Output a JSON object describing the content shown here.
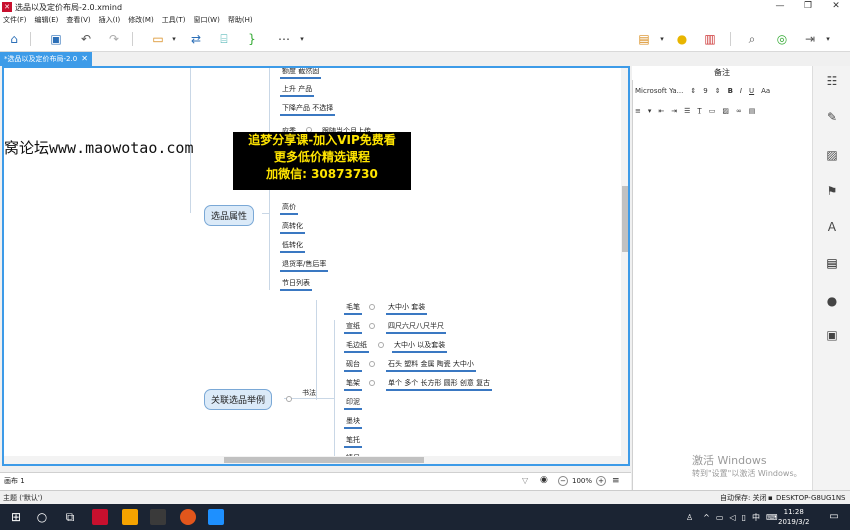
{
  "window": {
    "title": "选品以及定价布局-2.0.xmind",
    "min_icon": "—",
    "max_icon": "❐",
    "close_icon": "✕"
  },
  "menu": [
    "文件(F)",
    "编辑(E)",
    "查看(V)",
    "插入(I)",
    "修改(M)",
    "工具(T)",
    "窗口(W)",
    "帮助(H)"
  ],
  "tab": {
    "label": "*选品以及定价布局-2.0",
    "close": "✕"
  },
  "mindmap": {
    "top_leaves": [
      "额度 截然固",
      "上升 产品",
      "下降产品 不选择"
    ],
    "partial_leaf": "应季",
    "partial_leaf_detail": "跟随当个月上传",
    "topic1": "选品属性",
    "topic1_leaves": [
      "高价",
      "高转化",
      "低转化",
      "退货率/售后率",
      "节日列表"
    ],
    "topic2": "关联选品举例",
    "branch": "书法",
    "items": [
      {
        "name": "毛笔",
        "detail": "大中小 套装"
      },
      {
        "name": "宣纸",
        "detail": "四尺六尺八尺半尺"
      },
      {
        "name": "毛边纸",
        "detail": "大中小 以及套装"
      },
      {
        "name": "砚台",
        "detail": "石头 塑料 金属 陶瓷 大中小"
      },
      {
        "name": "笔架",
        "detail": "单个 多个 长方形 圆形 创意 复古"
      },
      {
        "name": "印泥",
        "detail": ""
      },
      {
        "name": "墨块",
        "detail": ""
      },
      {
        "name": "笔托",
        "detail": ""
      },
      {
        "name": "镇尺",
        "detail": ""
      }
    ]
  },
  "overlay": {
    "url_text": "窝论坛www.maowotao.com",
    "promo_lines": [
      "追梦分享课-加入VIP免费看",
      "更多低价精选课程",
      "加微信: 30873730"
    ]
  },
  "statusbar": {
    "sheet": "画布 1",
    "zoom": "100%",
    "zoom_minus": "−",
    "zoom_plus": "+"
  },
  "notes": {
    "title": "备注",
    "font": "Microsoft Ya...",
    "size": "9",
    "bold": "B",
    "italic": "I",
    "underline": "U",
    "case": "Aa"
  },
  "activation": {
    "title": "激活 Windows",
    "subtitle": "转到\"设置\"以激活 Windows。"
  },
  "bottom": {
    "theme": "主题 ('默认')",
    "autosave": "自动保存: 关闭",
    "computer": "DESKTOP-G8UG1NS"
  },
  "clock": {
    "time": "11:28",
    "date": "2019/3/2"
  },
  "tray_lang": "中"
}
